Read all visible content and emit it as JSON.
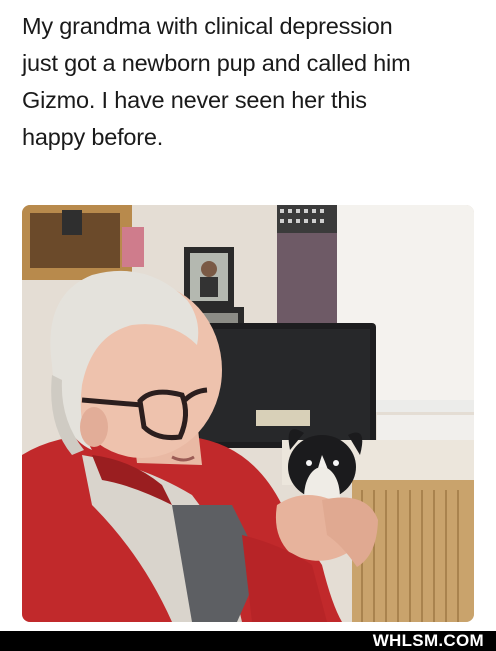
{
  "post": {
    "caption_lines": [
      "My grandma with clinical depression",
      "just got a newborn pup and called him",
      "Gizmo. I have never seen her this",
      "happy before."
    ]
  },
  "footer": {
    "brand": "WHLSM.COM"
  },
  "colors": {
    "background": "#ffffff",
    "text": "#1a1a1a",
    "footer_bg": "#000000",
    "footer_text": "#ffffff"
  }
}
